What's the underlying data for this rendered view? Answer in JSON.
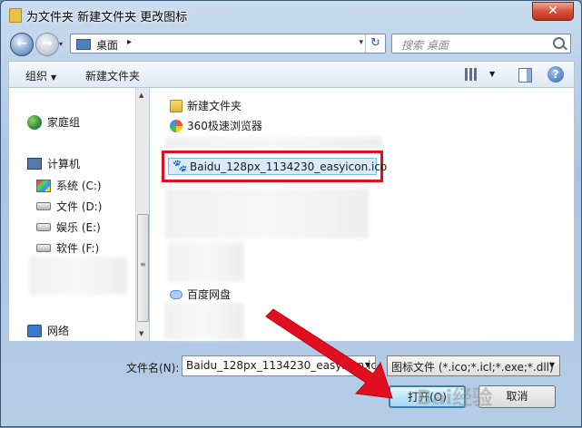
{
  "window": {
    "title": "为文件夹 新建文件夹 更改图标",
    "close_label": "✕"
  },
  "nav": {
    "back_label": "←",
    "forward_label": "→",
    "dropdown_label": "▾"
  },
  "address": {
    "location": "桌面",
    "separator": "▸",
    "dropdown_label": "▾",
    "refresh_label": "↻"
  },
  "search": {
    "placeholder": "搜索 桌面"
  },
  "toolbar": {
    "organize_label": "组织",
    "organize_dropdown": "▼",
    "new_folder_label": "新建文件夹",
    "view_dropdown": "▼",
    "help_label": "?"
  },
  "sidebar": {
    "homegroup": "家庭组",
    "computer": "计算机",
    "drives": [
      {
        "label": "系统 (C:)",
        "icon": "system-drive-icon"
      },
      {
        "label": "文件 (D:)",
        "icon": "drive-icon"
      },
      {
        "label": "娱乐 (E:)",
        "icon": "drive-icon"
      },
      {
        "label": "软件 (F:)",
        "icon": "drive-icon"
      }
    ],
    "network": "网络"
  },
  "scrollbar": {
    "up": "▲",
    "down": "▼",
    "grip": "≡"
  },
  "files": [
    {
      "label": "新建文件夹",
      "icon": "folder-icon"
    },
    {
      "label": "360极速浏览器",
      "icon": "browser-icon"
    },
    {
      "label": "Baidu_128px_1134230_easyicon.ico",
      "icon": "paw-icon",
      "selected": true
    },
    {
      "label": "百度网盘",
      "icon": "cloud-icon"
    }
  ],
  "filename": {
    "label": "文件名(N):",
    "value": "Baidu_128px_1134230_easyicon.ic",
    "dropdown": "▼"
  },
  "filetype": {
    "value": "图标文件 (*.ico;*.icl;*.exe;*.dll)",
    "dropdown": "▼"
  },
  "buttons": {
    "open": "打开(O)",
    "cancel": "取消"
  },
  "watermark": "Bai经验",
  "colors": {
    "highlight_box": "#e01020",
    "arrow": "#e01020",
    "selection": "#dbeaf9"
  }
}
